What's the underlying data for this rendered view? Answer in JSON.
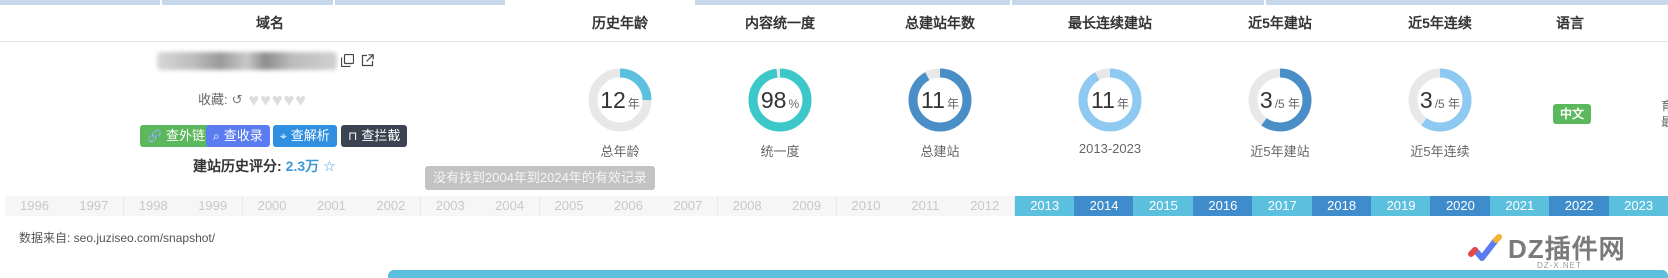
{
  "colors": {
    "accent_light": "#5bc0de",
    "accent_dark": "#3f8ccc",
    "donut_track": "#e8e8e8",
    "btn_green": "#5cb85c",
    "btn_blue": "#5b7cf0",
    "btn_azure": "#2f8fe0",
    "btn_dark": "#3b4350",
    "lang_badge": "#5cb85c"
  },
  "header": {
    "domain": "域名",
    "history_age": "历史年龄",
    "content_uniformity": "内容统一度",
    "total_years": "总建站年数",
    "longest_streak": "最长连续建站",
    "recent5_built": "近5年建站",
    "recent5_continuous": "近5年连续",
    "language": "语言"
  },
  "domain": {
    "copy_icon": "copy-icon",
    "external_icon": "external-link-icon",
    "favorite_label": "收藏:",
    "refresh_icon": "refresh-icon",
    "hearts": "♥♥♥♥♥",
    "buttons": {
      "links": "查外链",
      "index": "查收录",
      "dns": "查解析",
      "block": "查拦截"
    },
    "score_label": "建站历史评分:",
    "score_value": "2.3万",
    "score_icon": "star-icon"
  },
  "tooltip": "没有找到2004年到2024年的有效记录",
  "metrics": [
    {
      "value": "12",
      "unit": "年",
      "label": "总年龄",
      "fraction": 0.25,
      "color": "#5bc0de"
    },
    {
      "value": "98",
      "unit": "%",
      "label": "统一度",
      "fraction": 0.98,
      "color": "#3cc8c8"
    },
    {
      "value": "11",
      "unit": "年",
      "label": "总建站",
      "fraction": 0.92,
      "color": "#4a8ec8"
    },
    {
      "value": "11",
      "unit": "年",
      "label": "2013-2023",
      "fraction": 0.92,
      "color": "#8ec9f2"
    },
    {
      "value": "3",
      "unit": "/5 年",
      "label": "近5年建站",
      "fraction": 0.6,
      "color": "#4a8ec8"
    },
    {
      "value": "3",
      "unit": "/5 年",
      "label": "近5年连续",
      "fraction": 0.6,
      "color": "#8ec9f2"
    }
  ],
  "language": "中文",
  "edge_text": "育\n最",
  "years": [
    {
      "year": "1996",
      "state": "off"
    },
    {
      "year": "1997",
      "state": "off"
    },
    {
      "year": "1998",
      "state": "off"
    },
    {
      "year": "1999",
      "state": "off"
    },
    {
      "year": "2000",
      "state": "off"
    },
    {
      "year": "2001",
      "state": "off"
    },
    {
      "year": "2002",
      "state": "off"
    },
    {
      "year": "2003",
      "state": "off"
    },
    {
      "year": "2004",
      "state": "off"
    },
    {
      "year": "2005",
      "state": "off"
    },
    {
      "year": "2006",
      "state": "off"
    },
    {
      "year": "2007",
      "state": "off"
    },
    {
      "year": "2008",
      "state": "off"
    },
    {
      "year": "2009",
      "state": "off"
    },
    {
      "year": "2010",
      "state": "off"
    },
    {
      "year": "2011",
      "state": "off"
    },
    {
      "year": "2012",
      "state": "off"
    },
    {
      "year": "2013",
      "state": "on1"
    },
    {
      "year": "2014",
      "state": "on2"
    },
    {
      "year": "2015",
      "state": "on1"
    },
    {
      "year": "2016",
      "state": "on2"
    },
    {
      "year": "2017",
      "state": "on1"
    },
    {
      "year": "2018",
      "state": "on2"
    },
    {
      "year": "2019",
      "state": "on1"
    },
    {
      "year": "2020",
      "state": "on2"
    },
    {
      "year": "2021",
      "state": "on1"
    },
    {
      "year": "2022",
      "state": "on2"
    },
    {
      "year": "2023",
      "state": "on1"
    }
  ],
  "source": "数据来自: seo.juziseo.com/snapshot/",
  "watermark": {
    "title": "DZ插件网",
    "subtitle": "DZ-X.NET"
  }
}
